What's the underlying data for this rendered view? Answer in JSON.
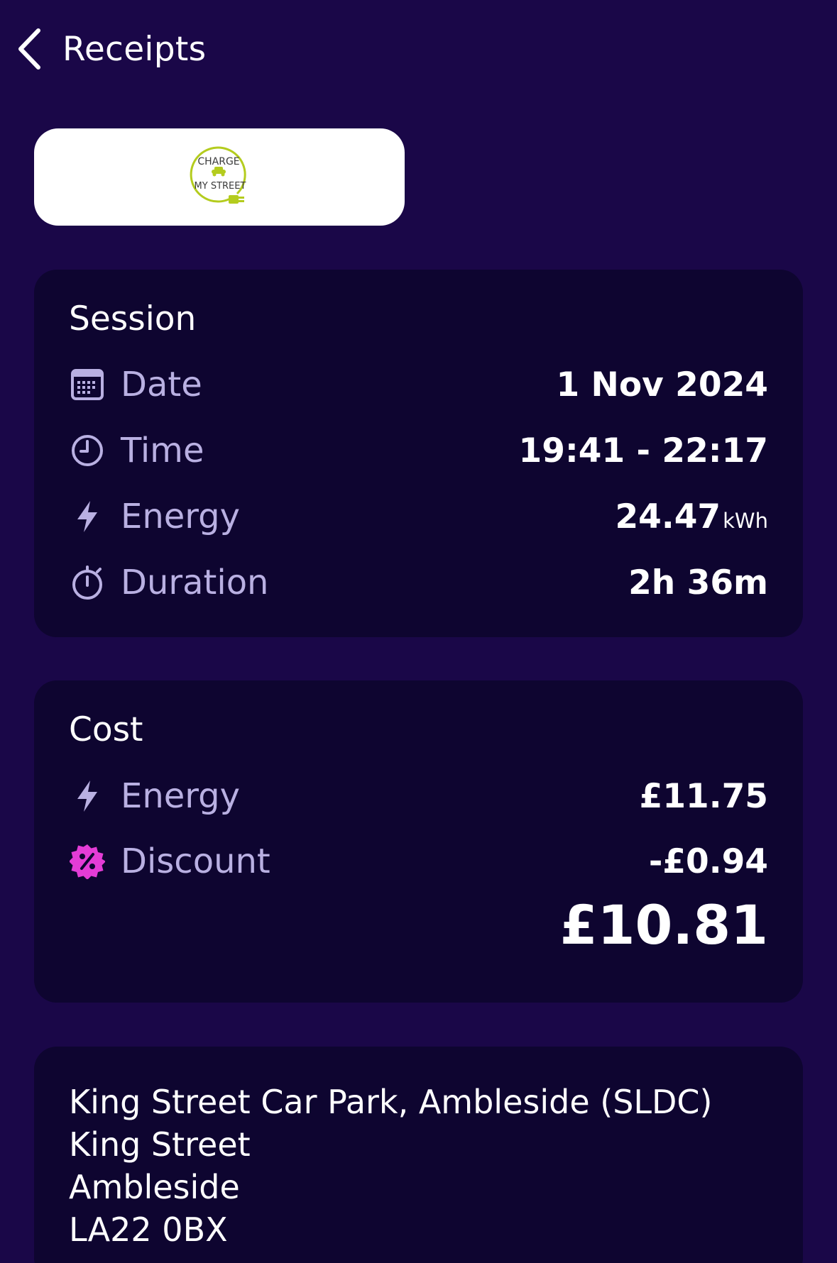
{
  "header": {
    "back_label": "Receipts"
  },
  "logo": {
    "line1": "CHARGE",
    "line2": "MY STREET",
    "accent": "#b4cc1e"
  },
  "session": {
    "title": "Session",
    "rows": [
      {
        "icon": "calendar-icon",
        "label": "Date",
        "value": "1 Nov 2024"
      },
      {
        "icon": "clock-icon",
        "label": "Time",
        "value": "19:41 - 22:17"
      },
      {
        "icon": "lightning-icon",
        "label": "Energy",
        "value": "24.47",
        "unit": "kWh"
      },
      {
        "icon": "stopwatch-icon",
        "label": "Duration",
        "value": "2h 36m"
      }
    ]
  },
  "cost": {
    "title": "Cost",
    "rows": [
      {
        "icon": "lightning-icon",
        "label": "Energy",
        "value": "£11.75"
      },
      {
        "icon": "discount-badge-icon",
        "label": "Discount",
        "value": "-£0.94"
      }
    ],
    "total": "£10.81"
  },
  "address": {
    "lines": [
      "King Street Car Park, Ambleside (SLDC)",
      "King Street",
      "Ambleside",
      "LA22 0BX"
    ]
  },
  "colors": {
    "background": "#1a0748",
    "card": "#0e0530",
    "muted_text": "#b9b0e2",
    "discount_icon": "#e43cd6"
  }
}
